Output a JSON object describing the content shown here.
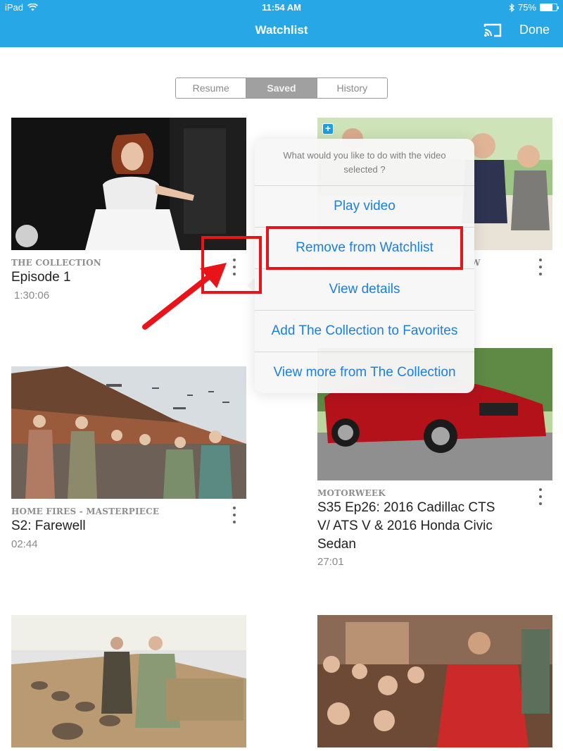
{
  "status_bar": {
    "device": "iPad",
    "time": "11:54 AM",
    "battery_percent": "75%",
    "battery_level": 0.75
  },
  "header": {
    "title": "Watchlist",
    "done_label": "Done",
    "cast_icon": "cast-icon",
    "accent_color": "#27a7e6"
  },
  "segments": [
    {
      "label": "Resume",
      "active": false
    },
    {
      "label": "Saved",
      "active": true
    },
    {
      "label": "History",
      "active": false
    }
  ],
  "cards": [
    {
      "show": "THE COLLECTION",
      "title": "Episode 1",
      "duration": "1:30:06"
    },
    {
      "show": "W",
      "title": "",
      "duration": ""
    },
    {
      "show": "HOME FIRES - MASTERPIECE",
      "title": "S2: Farewell",
      "duration": "02:44"
    },
    {
      "show": "MOTORWEEK",
      "title": "S35 Ep26: 2016 Cadillac CTS V/ ATS V & 2016 Honda Civic Sedan",
      "duration": "27:01"
    }
  ],
  "popover": {
    "question": "What would you like to do with the video selected ?",
    "items": [
      {
        "label": "Play video"
      },
      {
        "label": "Remove from Watchlist"
      },
      {
        "label": "View details"
      },
      {
        "label": "Add The Collection to Favorites"
      },
      {
        "label": "View more from The Collection"
      }
    ],
    "action_color": "#1b7fe4"
  },
  "annotation_color": "#e8141a"
}
